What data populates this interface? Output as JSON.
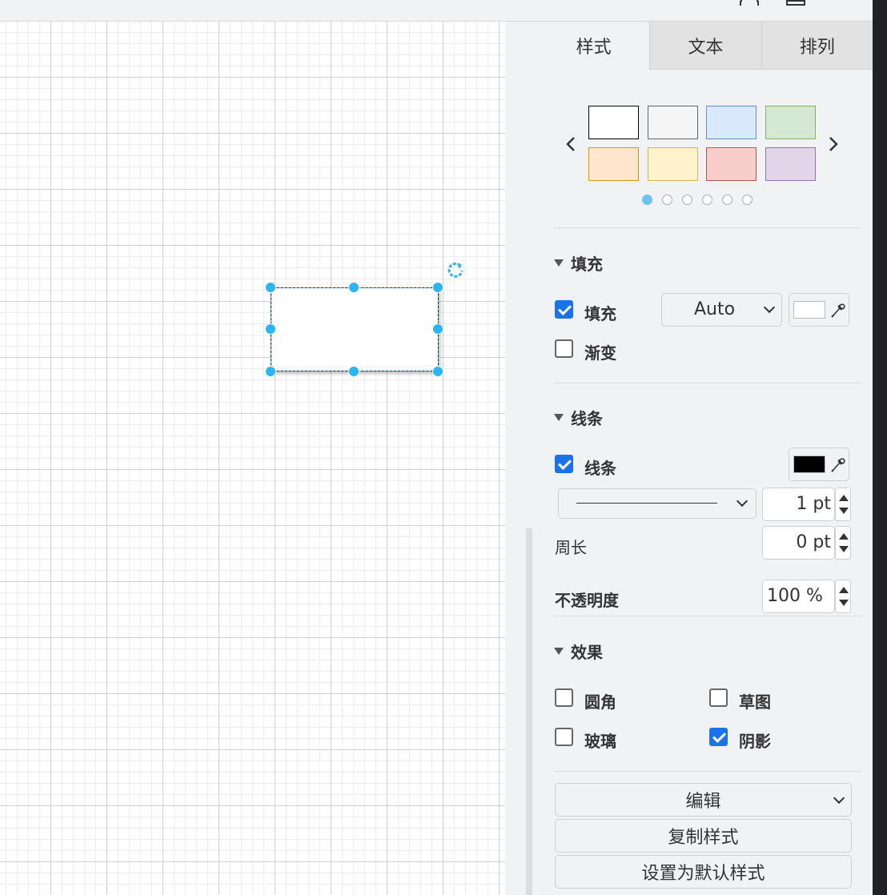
{
  "tabs": {
    "style": "样式",
    "text": "文本",
    "arrange": "排列"
  },
  "swatches": {
    "prev_icon": "chevron-left-icon",
    "next_icon": "chevron-right-icon",
    "colors": [
      {
        "fill": "#ffffff",
        "stroke": "#000000"
      },
      {
        "fill": "#f5f5f5",
        "stroke": "#666666"
      },
      {
        "fill": "#dae8fc",
        "stroke": "#6c8ebf"
      },
      {
        "fill": "#d5e8d4",
        "stroke": "#82b366"
      },
      {
        "fill": "#ffe6cc",
        "stroke": "#d79b00"
      },
      {
        "fill": "#fff2cc",
        "stroke": "#d6b656"
      },
      {
        "fill": "#f8cecc",
        "stroke": "#b85450"
      },
      {
        "fill": "#e1d5e7",
        "stroke": "#9673a6"
      }
    ],
    "page_count": 6,
    "active_page": 1
  },
  "fill_section": {
    "title": "填充",
    "fill_label": "填充",
    "fill_checked": true,
    "fill_mode": "Auto",
    "fill_color": "#ffffff",
    "gradient_label": "渐变",
    "gradient_checked": false
  },
  "line_section": {
    "title": "线条",
    "line_label": "线条",
    "line_checked": true,
    "line_color": "#000000",
    "width_value": "1 pt",
    "perimeter_label": "周长",
    "perimeter_value": "0 pt",
    "opacity_label": "不透明度",
    "opacity_value": "100 %"
  },
  "effects_section": {
    "title": "效果",
    "rounded_label": "圆角",
    "rounded_checked": false,
    "sketch_label": "草图",
    "sketch_checked": false,
    "glass_label": "玻璃",
    "glass_checked": false,
    "shadow_label": "阴影",
    "shadow_checked": true
  },
  "actions": {
    "edit_label": "编辑",
    "copy_style_label": "复制样式",
    "set_default_label": "设置为默认样式"
  },
  "colors": {
    "selection": "#29b6f2",
    "accent": "#1a73e8"
  }
}
